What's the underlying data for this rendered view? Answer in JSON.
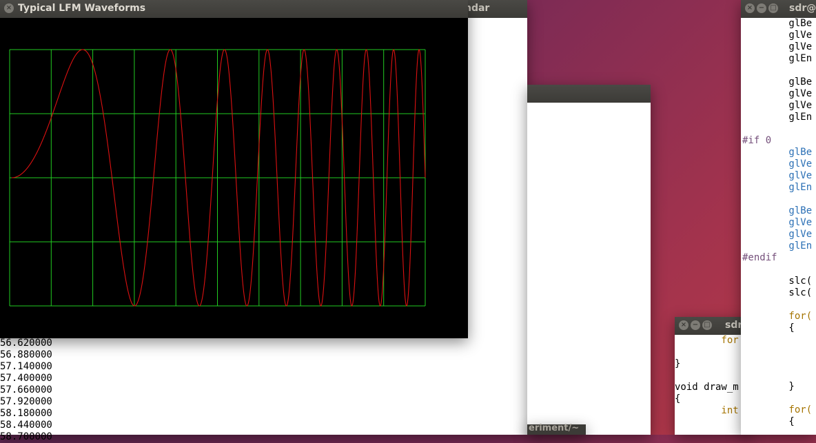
{
  "background_terminal": {
    "title": "ndar",
    "lines": [
      "56.620000",
      "56.880000",
      "57.140000",
      "57.400000",
      "57.660000",
      "57.920000",
      "58.180000",
      "58.440000",
      "58.700000"
    ]
  },
  "bottom_window": {
    "title": "eriment/~"
  },
  "small_code_window": {
    "title": "sdr",
    "lines": [
      {
        "text": "        for",
        "style": "kw"
      },
      {
        "text": "",
        "style": "fn"
      },
      {
        "text": "}",
        "style": "fn"
      },
      {
        "text": "",
        "style": "fn"
      },
      {
        "text": "void draw_m",
        "style": "fn"
      },
      {
        "text": "{",
        "style": "fn"
      },
      {
        "text": "        int",
        "style": "kw"
      }
    ]
  },
  "right_code_window": {
    "title": "sdr@",
    "lines": [
      {
        "text": "        glBe",
        "style": "fn"
      },
      {
        "text": "        glVe",
        "style": "fn"
      },
      {
        "text": "        glVe",
        "style": "fn"
      },
      {
        "text": "        glEn",
        "style": "fn"
      },
      {
        "text": "",
        "style": "fn"
      },
      {
        "text": "        glBe",
        "style": "fn"
      },
      {
        "text": "        glVe",
        "style": "fn"
      },
      {
        "text": "        glVe",
        "style": "fn"
      },
      {
        "text": "        glEn",
        "style": "fn"
      },
      {
        "text": "",
        "style": "fn"
      },
      {
        "text": "#if 0",
        "style": "pre"
      },
      {
        "text": "        glBe",
        "style": "blue"
      },
      {
        "text": "        glVe",
        "style": "blue"
      },
      {
        "text": "        glVe",
        "style": "blue"
      },
      {
        "text": "        glEn",
        "style": "blue"
      },
      {
        "text": "",
        "style": "fn"
      },
      {
        "text": "        glBe",
        "style": "blue"
      },
      {
        "text": "        glVe",
        "style": "blue"
      },
      {
        "text": "        glVe",
        "style": "blue"
      },
      {
        "text": "        glEn",
        "style": "blue"
      },
      {
        "text": "#endif",
        "style": "pre"
      },
      {
        "text": "",
        "style": "fn"
      },
      {
        "text": "        slc(",
        "style": "fn"
      },
      {
        "text": "        slc(",
        "style": "fn"
      },
      {
        "text": "",
        "style": "fn"
      },
      {
        "text": "        for(",
        "style": "kw"
      },
      {
        "text": "        {",
        "style": "fn"
      },
      {
        "text": "",
        "style": "fn"
      },
      {
        "text": "",
        "style": "fn"
      },
      {
        "text": "",
        "style": "fn"
      },
      {
        "text": "",
        "style": "fn"
      },
      {
        "text": "        }",
        "style": "fn"
      },
      {
        "text": "",
        "style": "fn"
      },
      {
        "text": "        for(",
        "style": "kw"
      },
      {
        "text": "        {",
        "style": "fn"
      }
    ]
  },
  "lfm_window": {
    "title": "Typical LFM Waveforms",
    "colors": {
      "grid": "#22cc22",
      "waveform": "#dd1111",
      "background": "#000000"
    }
  },
  "chart_data": {
    "type": "line",
    "title": "",
    "xlabel": "",
    "ylabel": "",
    "grid": true,
    "grid_divisions": {
      "x": 10,
      "y": 4
    },
    "ylim": [
      -1,
      1
    ],
    "xlim": [
      0,
      1
    ],
    "series": [
      {
        "signal": "LFM chirp",
        "start_frequency_cycles": 0,
        "end_frequency_cycles": 17,
        "start_phase_deg": 0
      }
    ]
  }
}
